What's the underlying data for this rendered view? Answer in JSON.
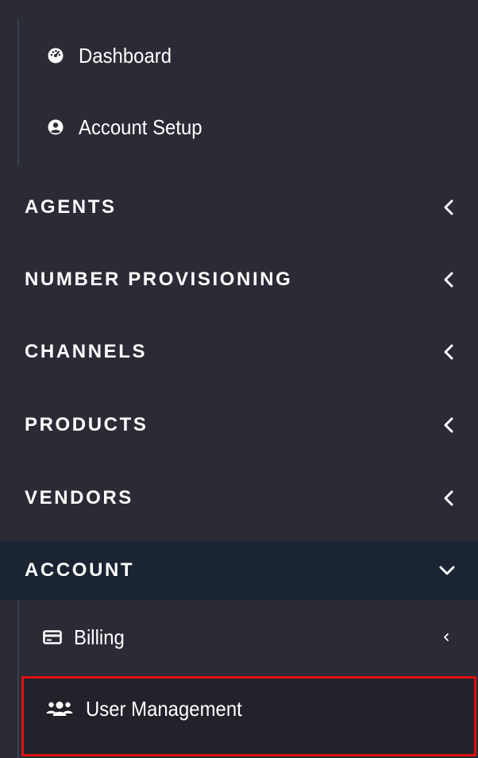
{
  "sidebar": {
    "top_items": [
      {
        "label": "Dashboard",
        "icon": "tachometer-icon"
      },
      {
        "label": "Account Setup",
        "icon": "user-circle-icon"
      }
    ],
    "sections": [
      {
        "label": "AGENTS",
        "state": "collapsed"
      },
      {
        "label": "NUMBER PROVISIONING",
        "state": "collapsed"
      },
      {
        "label": "CHANNELS",
        "state": "collapsed"
      },
      {
        "label": "PRODUCTS",
        "state": "collapsed"
      },
      {
        "label": "VENDORS",
        "state": "collapsed"
      },
      {
        "label": "ACCOUNT",
        "state": "expanded"
      }
    ],
    "account_items": [
      {
        "label": "Billing",
        "icon": "credit-card-icon",
        "has_submenu": true
      },
      {
        "label": "User Management",
        "icon": "users-icon",
        "selected": true
      }
    ]
  },
  "colors": {
    "background": "#2a2b35",
    "expanded_section_background": "#1b2433",
    "selection_outline": "#e01010",
    "text": "#ffffff"
  }
}
